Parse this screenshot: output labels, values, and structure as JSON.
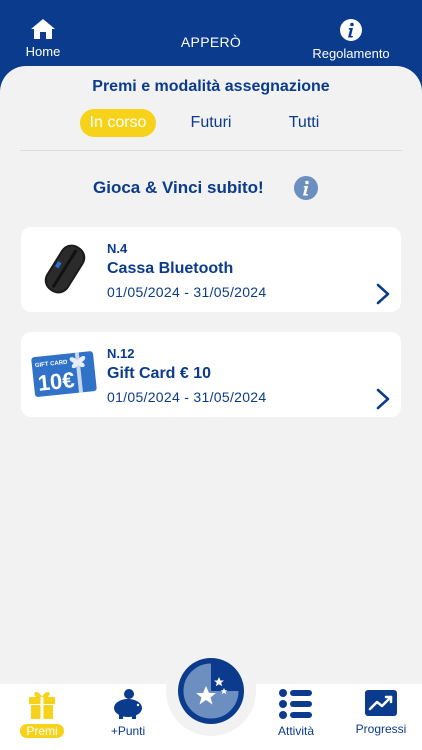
{
  "header": {
    "home_label": "Home",
    "title": "APPERÒ",
    "rules_label": "Regolamento"
  },
  "prizes_section": {
    "title": "Premi e modalità assegnazione",
    "tabs": [
      {
        "label": "In corso",
        "active": true
      },
      {
        "label": "Futuri",
        "active": false
      },
      {
        "label": "Tutti",
        "active": false
      }
    ],
    "game_title": "Gioca & Vinci subito!"
  },
  "prizes": [
    {
      "number": "N.4",
      "name": "Cassa Bluetooth",
      "dates": "01/05/2024 - 31/05/2024",
      "thumb_icon": "bluetooth-speaker-image"
    },
    {
      "number": "N.12",
      "name": "Gift Card € 10",
      "dates": "01/05/2024 - 31/05/2024",
      "thumb_icon": "gift-card-image",
      "thumb_text": "GIFT CARD",
      "thumb_value": "10€"
    }
  ],
  "bottom_nav": {
    "items": [
      {
        "label": "Premi",
        "icon": "gift-icon",
        "active": true
      },
      {
        "label": "+Punti",
        "icon": "piggy-bank-icon",
        "active": false
      },
      {
        "label": "",
        "icon": "stars-play-icon",
        "active": false
      },
      {
        "label": "Attività",
        "icon": "list-icon",
        "active": false
      },
      {
        "label": "Progressi",
        "icon": "trend-chart-icon",
        "active": false
      }
    ]
  },
  "colors": {
    "primary": "#0b3b8c",
    "accent_yellow": "#f7d21a",
    "info_blue": "#6c8fc0",
    "background": "#f2f2f2"
  }
}
